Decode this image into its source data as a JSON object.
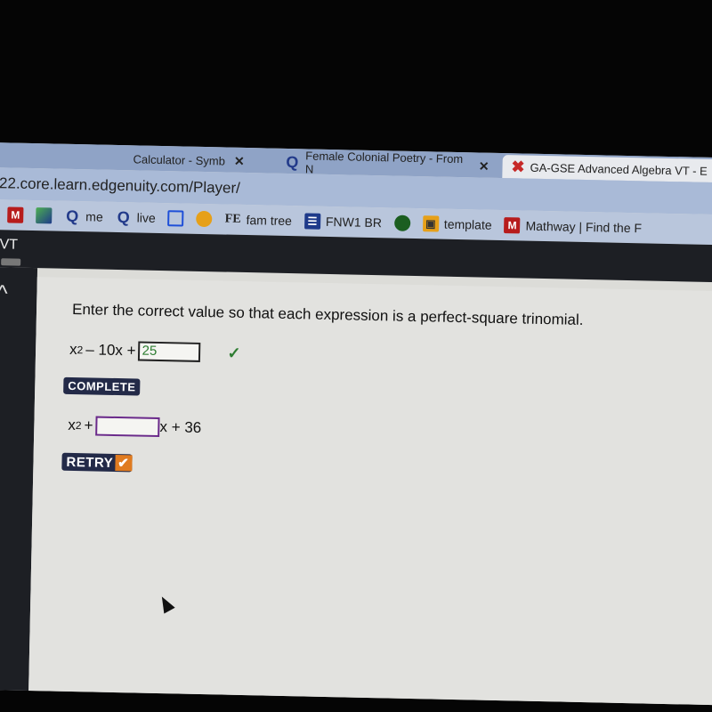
{
  "browser": {
    "tabs": [
      {
        "label": "Calculator - Symb",
        "close": "✕"
      },
      {
        "label": "Female Colonial Poetry - From N",
        "close": "✕"
      },
      {
        "label": "GA-GSE Advanced Algebra VT - E",
        "active": true
      }
    ],
    "url": "22.core.learn.edgenuity.com/Player/",
    "bookmarks": [
      {
        "icon": "M",
        "label": ""
      },
      {
        "icon": "maps-icon",
        "label": ""
      },
      {
        "icon": "Q",
        "label": "me"
      },
      {
        "icon": "Q",
        "label": "live"
      },
      {
        "icon": "layout-icon",
        "label": ""
      },
      {
        "icon": "shield-icon",
        "label": ""
      },
      {
        "icon": "FE",
        "label": "fam tree"
      },
      {
        "icon": "list-icon",
        "label": "FNW1 BR"
      },
      {
        "icon": "chat-icon",
        "label": ""
      },
      {
        "icon": "contact-icon",
        "label": "template"
      },
      {
        "icon": "M",
        "label": "Mathway | Find the F"
      }
    ]
  },
  "app": {
    "header_title": "VT"
  },
  "question": {
    "prompt": "Enter the correct value so that each expression is a perfect-square trinomial.",
    "item1": {
      "lead": "x",
      "exp": "2",
      "rest": "– 10x +",
      "answer": "25",
      "check": "✓",
      "status": "COMPLETE"
    },
    "item2": {
      "lead": "x",
      "exp": "2",
      "rest": "+",
      "answer": "",
      "tail": "x + 36",
      "status": "RETRY",
      "status_icon": "✔"
    }
  },
  "colors": {
    "correct": "#2e7d32",
    "badge": "#232a48",
    "retry_check": "#e07b20"
  }
}
